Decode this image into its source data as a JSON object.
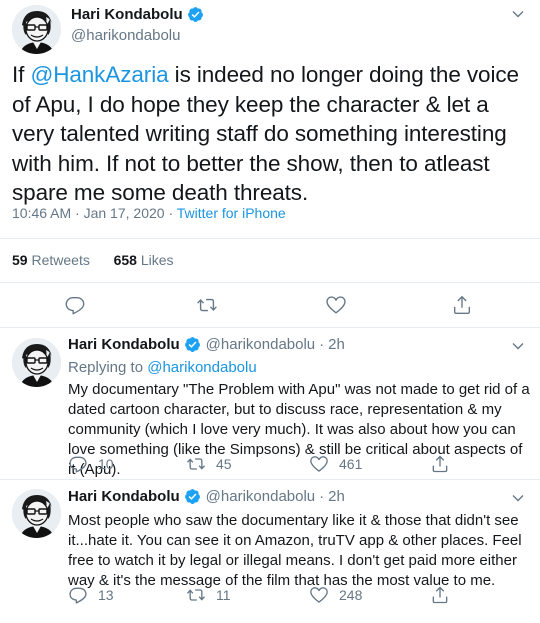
{
  "main_tweet": {
    "author_name": "Hari Kondabolu",
    "author_handle": "@harikondabolu",
    "text_before_mention": "If ",
    "mention": "@HankAzaria",
    "text_after_mention": " is indeed no longer doing the voice of Apu, I do hope they keep the character & let a very talented writing staff do something interesting with him. If not to better the show, then to atleast spare me some death threats.",
    "timestamp": "10:46 AM · Jan 17, 2020 · ",
    "source": "Twitter for iPhone",
    "retweets_count": "59",
    "retweets_label": "Retweets",
    "likes_count": "658",
    "likes_label": "Likes"
  },
  "replies": [
    {
      "author_name": "Hari Kondabolu",
      "author_handle": "@harikondabolu",
      "time": "2h",
      "replying_to_label": "Replying to ",
      "replying_to_handle": "@harikondabolu",
      "text": "My documentary \"The Problem with Apu\" was not made to get rid of a dated cartoon character, but to discuss race, representation & my community (which I love very much). It was also about how you can love something (like the Simpsons) & still be critical about aspects of it (Apu).",
      "replies_count": "10",
      "retweets_count": "45",
      "likes_count": "461"
    },
    {
      "author_name": "Hari Kondabolu",
      "author_handle": "@harikondabolu",
      "time": "2h",
      "text": "Most people who saw the documentary like it & those that didn't see it...hate it. You can see it on Amazon, truTV app & other places. Feel free to watch it by legal or illegal means. I don't get paid more either way & it's the message of the film that has the most value to me.",
      "replies_count": "13",
      "retweets_count": "11",
      "likes_count": "248"
    }
  ],
  "icons": {
    "verified": "verified-badge-icon",
    "more": "chevron-down-icon",
    "reply": "reply-icon",
    "retweet": "retweet-icon",
    "like": "heart-icon",
    "share": "share-icon"
  },
  "colors": {
    "accent": "#1b95e0",
    "text": "#14171a",
    "secondary": "#657786",
    "divider": "#e6ecf0"
  }
}
